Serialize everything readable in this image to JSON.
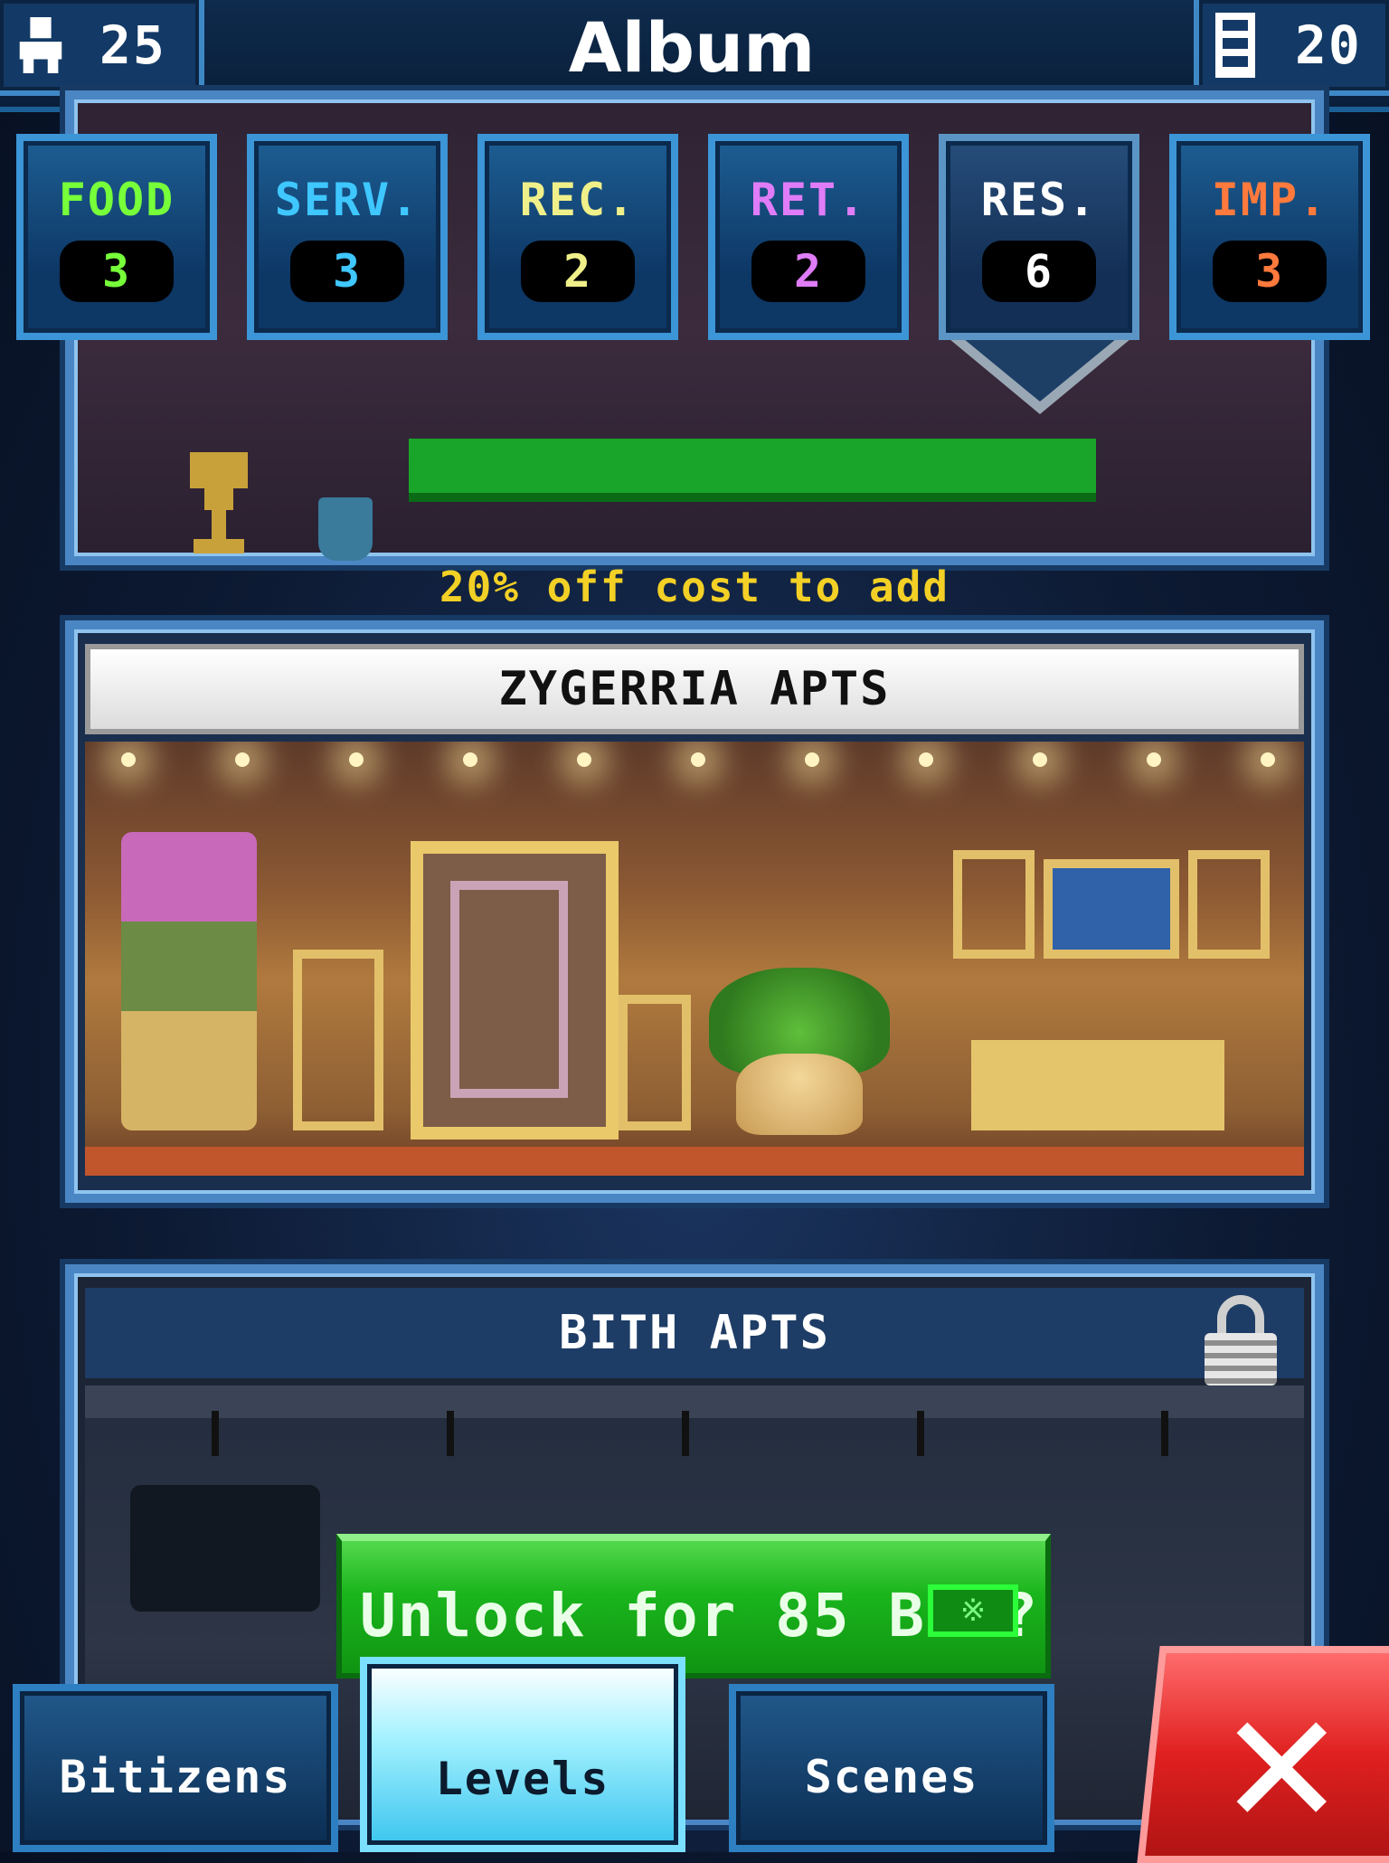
{
  "header": {
    "title": "Album",
    "population": "25",
    "floors": "20"
  },
  "categories": [
    {
      "label": "FOOD",
      "count": "3",
      "color": "#77ff3a"
    },
    {
      "label": "SERV.",
      "count": "3",
      "color": "#3fc7ff"
    },
    {
      "label": "REC.",
      "count": "2",
      "color": "#f0f08a"
    },
    {
      "label": "RET.",
      "count": "2",
      "color": "#e07cf7"
    },
    {
      "label": "RES.",
      "count": "6",
      "color": "#ffffff",
      "selected": true
    },
    {
      "label": "IMP.",
      "count": "3",
      "color": "#ff7a3c"
    }
  ],
  "levels": [
    {
      "discount": "20% off cost to add"
    },
    {
      "name": "ZYGERRIA APTS"
    },
    {
      "name": "BITH APTS",
      "locked": true
    }
  ],
  "unlock": {
    "text": "Unlock for 85 Bux?",
    "currency_icon": "bux-icon"
  },
  "nav": {
    "bitizens": "Bitizens",
    "levels": "Levels",
    "scenes": "Scenes",
    "active": "levels"
  },
  "close_icon": "close-icon"
}
